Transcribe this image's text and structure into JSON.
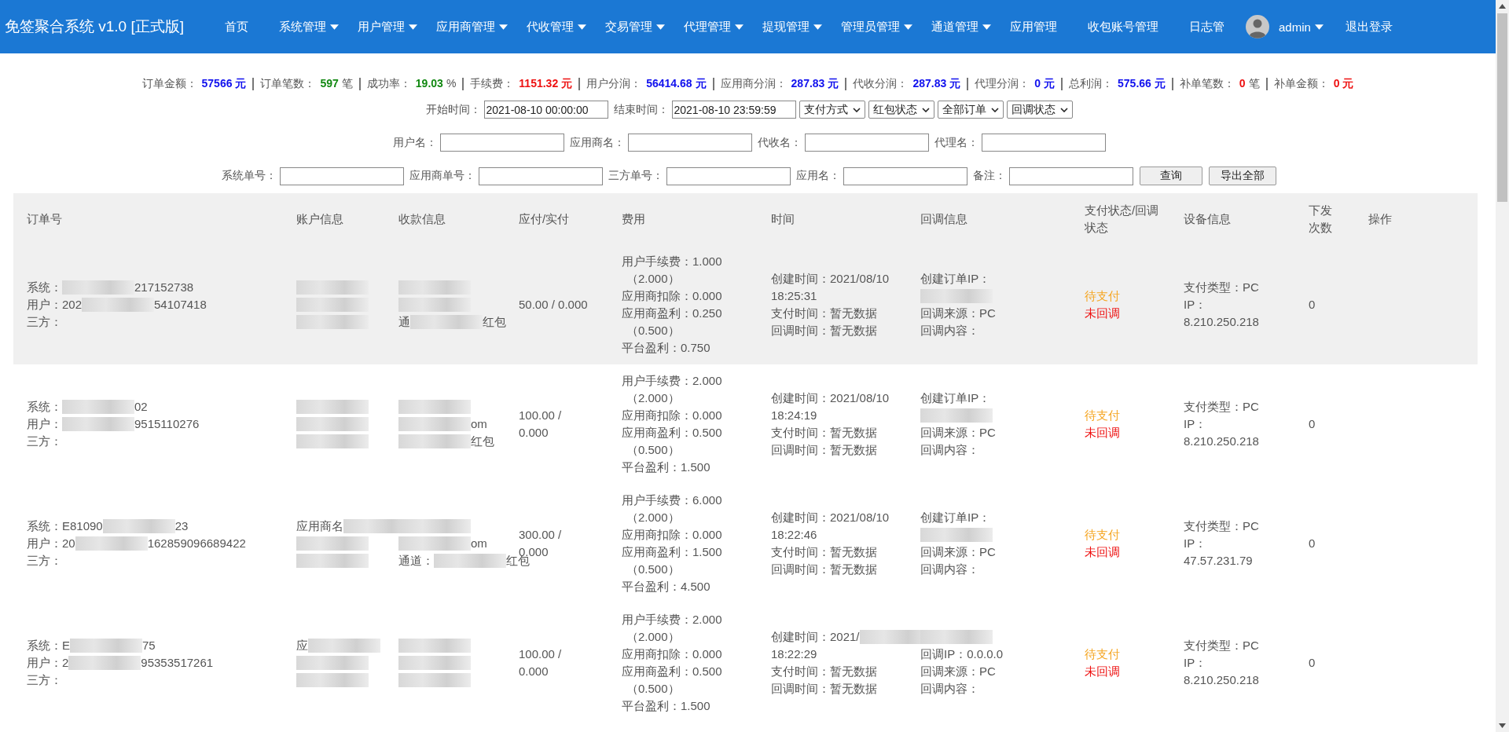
{
  "header": {
    "title": "免签聚合系统 v1.0 [正式版]",
    "nav": [
      {
        "label": "首页",
        "dropdown": false
      },
      {
        "label": "系统管理",
        "dropdown": true
      },
      {
        "label": "用户管理",
        "dropdown": true
      },
      {
        "label": "应用商管理",
        "dropdown": true
      },
      {
        "label": "代收管理",
        "dropdown": true
      },
      {
        "label": "交易管理",
        "dropdown": true
      },
      {
        "label": "代理管理",
        "dropdown": true
      },
      {
        "label": "提现管理",
        "dropdown": true
      },
      {
        "label": "管理员管理",
        "dropdown": true
      },
      {
        "label": "通道管理",
        "dropdown": true
      },
      {
        "label": "应用管理",
        "dropdown": false
      },
      {
        "label": "收包账号管理",
        "dropdown": false
      },
      {
        "label": "日志管",
        "dropdown": false
      }
    ],
    "user": "admin",
    "logout": "退出登录"
  },
  "stats": [
    {
      "label": "订单金额：",
      "value": "57566",
      "unit": "元",
      "color": "#1010ee",
      "unit_highlight": true
    },
    {
      "label": "订单笔数：",
      "value": "597",
      "unit": "笔",
      "color": "#118811",
      "unit_highlight": false
    },
    {
      "label": "成功率：",
      "value": "19.03",
      "unit": "%",
      "color": "#118811",
      "unit_highlight": false
    },
    {
      "label": "手续费：",
      "value": "1151.32",
      "unit": "元",
      "color": "#ee1111",
      "unit_highlight": true
    },
    {
      "label": "用户分润：",
      "value": "56414.68",
      "unit": "元",
      "color": "#1010ee",
      "unit_highlight": true
    },
    {
      "label": "应用商分润：",
      "value": "287.83",
      "unit": "元",
      "color": "#1010ee",
      "unit_highlight": true
    },
    {
      "label": "代收分润：",
      "value": "287.83",
      "unit": "元",
      "color": "#1010ee",
      "unit_highlight": true
    },
    {
      "label": "代理分润：",
      "value": "0",
      "unit": "元",
      "color": "#1010ee",
      "unit_highlight": true
    },
    {
      "label": "总利润：",
      "value": "575.66",
      "unit": "元",
      "color": "#1010ee",
      "unit_highlight": true
    },
    {
      "label": "补单笔数：",
      "value": "0",
      "unit": "笔",
      "color": "#ee1111",
      "unit_highlight": false
    },
    {
      "label": "补单金额：",
      "value": "0",
      "unit": "元",
      "color": "#ee1111",
      "unit_highlight": true
    }
  ],
  "filters": [
    [
      {
        "kind": "input",
        "label": "开始时间：",
        "value": "2021-08-10 00:00:00"
      },
      {
        "kind": "input",
        "label": "结束时间：",
        "value": "2021-08-10 23:59:59"
      },
      {
        "kind": "select",
        "value": "支付方式"
      },
      {
        "kind": "select",
        "value": "红包状态"
      },
      {
        "kind": "select",
        "value": "全部订单"
      },
      {
        "kind": "select",
        "value": "回调状态"
      }
    ],
    [
      {
        "kind": "input",
        "label": "用户名："
      },
      {
        "kind": "input",
        "label": "应用商名："
      },
      {
        "kind": "input",
        "label": "代收名："
      },
      {
        "kind": "input",
        "label": "代理名："
      }
    ],
    [
      {
        "kind": "input",
        "label": "系统单号："
      },
      {
        "kind": "input",
        "label": "应用商单号："
      },
      {
        "kind": "input",
        "label": "三方单号："
      },
      {
        "kind": "input",
        "label": "应用名："
      },
      {
        "kind": "input",
        "label": "备注："
      },
      {
        "kind": "button",
        "value": "查询"
      },
      {
        "kind": "button",
        "value": "导出全部"
      }
    ]
  ],
  "table": {
    "columns": [
      "订单号",
      "账户信息",
      "收款信息",
      "应付/实付",
      "费用",
      "时间",
      "回调信息",
      "支付状态/回调状态",
      "设备信息",
      "下发次数",
      "操作"
    ],
    "rows": [
      {
        "selected": true,
        "order": [
          [
            {
              "kind": "text",
              "text": "系统："
            },
            {
              "kind": "blur"
            },
            {
              "kind": "text",
              "text": "217152738"
            }
          ],
          [
            {
              "kind": "text",
              "text": "用户：202"
            },
            {
              "kind": "blur"
            },
            {
              "kind": "text",
              "text": "54107418"
            }
          ],
          [
            {
              "kind": "text",
              "text": "三方："
            }
          ]
        ],
        "account": [
          [
            {
              "kind": "blur"
            }
          ],
          [
            {
              "kind": "blur"
            }
          ],
          [
            {
              "kind": "blur"
            }
          ]
        ],
        "collection": [
          [
            {
              "kind": "blur"
            }
          ],
          [
            {
              "kind": "blur"
            }
          ],
          [
            {
              "kind": "text",
              "text": "通"
            },
            {
              "kind": "blur"
            },
            {
              "kind": "text",
              "text": "红包"
            }
          ]
        ],
        "amount": "50.00 / 0.000",
        "fees": [
          "用户手续费：1.000",
          "（2.000）",
          "应用商扣除：0.000",
          "应用商盈利：0.250",
          "（0.500）",
          "平台盈利：0.750"
        ],
        "time": [
          [
            {
              "kind": "text",
              "text": "创建时间：2021/08/10"
            }
          ],
          [
            {
              "kind": "text",
              "text": "18:25:31"
            }
          ],
          [
            {
              "kind": "text",
              "text": "支付时间：暂无数据"
            }
          ],
          [
            {
              "kind": "text",
              "text": "回调时间：暂无数据"
            }
          ]
        ],
        "callback": [
          [
            {
              "kind": "text",
              "text": "创建订单IP："
            }
          ],
          [
            {
              "kind": "blur"
            }
          ],
          [
            {
              "kind": "text",
              "text": "回调来源：PC"
            }
          ],
          [
            {
              "kind": "text",
              "text": "回调内容："
            }
          ]
        ],
        "pay_status": {
          "kind": "pending",
          "text": "待支付"
        },
        "cb_status": {
          "kind": "failed",
          "text": "未回调"
        },
        "device": [
          "支付类型：PC",
          "IP：",
          "8.210.250.218"
        ],
        "count": "0"
      },
      {
        "selected": false,
        "order": [
          [
            {
              "kind": "text",
              "text": "系统："
            },
            {
              "kind": "blur"
            },
            {
              "kind": "text",
              "text": "02"
            }
          ],
          [
            {
              "kind": "text",
              "text": "用户："
            },
            {
              "kind": "blur"
            },
            {
              "kind": "text",
              "text": "9515110276"
            }
          ],
          [
            {
              "kind": "text",
              "text": "三方："
            }
          ]
        ],
        "account": [
          [
            {
              "kind": "blur"
            }
          ],
          [
            {
              "kind": "blur"
            }
          ],
          [
            {
              "kind": "blur"
            }
          ]
        ],
        "collection": [
          [
            {
              "kind": "blur"
            }
          ],
          [
            {
              "kind": "blur"
            },
            {
              "kind": "text",
              "text": "om"
            }
          ],
          [
            {
              "kind": "blur"
            },
            {
              "kind": "text",
              "text": "红包"
            }
          ]
        ],
        "amount": "100.00 / 0.000",
        "fees": [
          "用户手续费：2.000",
          "（2.000）",
          "应用商扣除：0.000",
          "应用商盈利：0.500",
          "（0.500）",
          "平台盈利：1.500"
        ],
        "time": [
          [
            {
              "kind": "text",
              "text": "创建时间：2021/08/10"
            }
          ],
          [
            {
              "kind": "text",
              "text": "18:24:19"
            }
          ],
          [
            {
              "kind": "text",
              "text": "支付时间：暂无数据"
            }
          ],
          [
            {
              "kind": "text",
              "text": "回调时间：暂无数据"
            }
          ]
        ],
        "callback": [
          [
            {
              "kind": "text",
              "text": "创建订单IP："
            }
          ],
          [
            {
              "kind": "blur"
            }
          ],
          [
            {
              "kind": "text",
              "text": "回调来源：PC"
            }
          ],
          [
            {
              "kind": "text",
              "text": "回调内容："
            }
          ]
        ],
        "pay_status": {
          "kind": "pending",
          "text": "待支付"
        },
        "cb_status": {
          "kind": "failed",
          "text": "未回调"
        },
        "device": [
          "支付类型：PC",
          "IP：",
          "8.210.250.218"
        ],
        "count": "0"
      },
      {
        "selected": false,
        "order": [
          [
            {
              "kind": "text",
              "text": "系统：E81090"
            },
            {
              "kind": "blur"
            },
            {
              "kind": "text",
              "text": "23"
            }
          ],
          [
            {
              "kind": "text",
              "text": "用户：20"
            },
            {
              "kind": "blur"
            },
            {
              "kind": "text",
              "text": "162859096689422"
            }
          ],
          [
            {
              "kind": "text",
              "text": "三方："
            }
          ]
        ],
        "account": [
          [
            {
              "kind": "text",
              "text": "应用商名"
            },
            {
              "kind": "blur"
            }
          ],
          [
            {
              "kind": "blur"
            }
          ],
          [
            {
              "kind": "blur"
            }
          ]
        ],
        "collection": [
          [
            {
              "kind": "blur"
            }
          ],
          [
            {
              "kind": "blur"
            },
            {
              "kind": "text",
              "text": "om"
            }
          ],
          [
            {
              "kind": "text",
              "text": "通道："
            },
            {
              "kind": "blur"
            },
            {
              "kind": "text",
              "text": "红包"
            }
          ]
        ],
        "amount": "300.00 / 0.000",
        "fees": [
          "用户手续费：6.000",
          "（2.000）",
          "应用商扣除：0.000",
          "应用商盈利：1.500",
          "（0.500）",
          "平台盈利：4.500"
        ],
        "time": [
          [
            {
              "kind": "text",
              "text": "创建时间：2021/08/10"
            }
          ],
          [
            {
              "kind": "text",
              "text": "18:22:46"
            }
          ],
          [
            {
              "kind": "text",
              "text": "支付时间：暂无数据"
            }
          ],
          [
            {
              "kind": "text",
              "text": "回调时间：暂无数据"
            }
          ]
        ],
        "callback": [
          [
            {
              "kind": "text",
              "text": "创建订单IP："
            }
          ],
          [
            {
              "kind": "blur"
            }
          ],
          [
            {
              "kind": "text",
              "text": "回调来源：PC"
            }
          ],
          [
            {
              "kind": "text",
              "text": "回调内容："
            }
          ]
        ],
        "pay_status": {
          "kind": "pending",
          "text": "待支付"
        },
        "cb_status": {
          "kind": "failed",
          "text": "未回调"
        },
        "device": [
          "支付类型：PC",
          "IP：",
          "47.57.231.79"
        ],
        "count": "0"
      },
      {
        "selected": false,
        "order": [
          [
            {
              "kind": "text",
              "text": "系统：E"
            },
            {
              "kind": "blur"
            },
            {
              "kind": "text",
              "text": "75"
            }
          ],
          [
            {
              "kind": "text",
              "text": "用户：2"
            },
            {
              "kind": "blur"
            },
            {
              "kind": "text",
              "text": "95353517261"
            }
          ],
          [
            {
              "kind": "text",
              "text": "三方："
            }
          ]
        ],
        "account": [
          [
            {
              "kind": "text",
              "text": "应"
            },
            {
              "kind": "blur"
            }
          ],
          [
            {
              "kind": "blur"
            }
          ],
          [
            {
              "kind": "blur"
            }
          ]
        ],
        "collection": [
          [
            {
              "kind": "blur"
            }
          ],
          [
            {
              "kind": "blur"
            }
          ],
          [
            {
              "kind": "blur"
            }
          ]
        ],
        "amount": "100.00 / 0.000",
        "fees": [
          "用户手续费：2.000",
          "（2.000）",
          "应用商扣除：0.000",
          "应用商盈利：0.500",
          "（0.500）",
          "平台盈利：1.500"
        ],
        "time": [
          [
            {
              "kind": "text",
              "text": "创建时间：2021/"
            },
            {
              "kind": "blur"
            }
          ],
          [
            {
              "kind": "text",
              "text": "18:22:29"
            }
          ],
          [
            {
              "kind": "text",
              "text": "支付时间：暂无数据"
            }
          ],
          [
            {
              "kind": "text",
              "text": "回调时间：暂无数据"
            }
          ]
        ],
        "callback": [
          [
            {
              "kind": "blur"
            }
          ],
          [
            {
              "kind": "text",
              "text": "回调IP：0.0.0.0"
            }
          ],
          [
            {
              "kind": "text",
              "text": "回调来源：PC"
            }
          ],
          [
            {
              "kind": "text",
              "text": "回调内容："
            }
          ]
        ],
        "pay_status": {
          "kind": "pending",
          "text": "待支付"
        },
        "cb_status": {
          "kind": "failed",
          "text": "未回调"
        },
        "device": [
          "支付类型：PC",
          "IP：",
          "8.210.250.218"
        ],
        "count": "0"
      }
    ]
  }
}
